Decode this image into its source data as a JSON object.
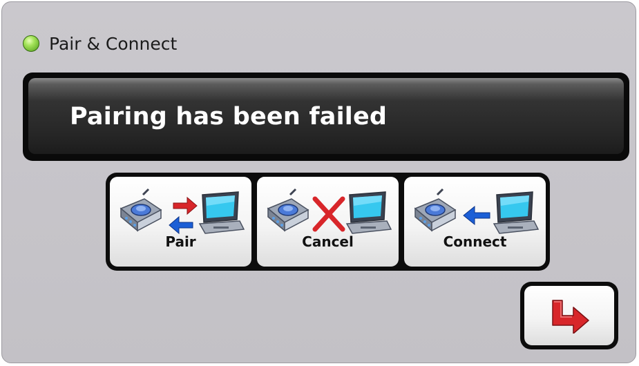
{
  "header": {
    "title": "Pair & Connect",
    "status_color": "#7cc832"
  },
  "message": {
    "text": "Pairing has been failed"
  },
  "actions": [
    {
      "label": "Pair",
      "icon": "device-pair-icon"
    },
    {
      "label": "Cancel",
      "icon": "device-cancel-icon"
    },
    {
      "label": "Connect",
      "icon": "device-connect-icon"
    }
  ],
  "navigation": {
    "next_icon": "forward-arrow-icon"
  },
  "colors": {
    "accent_red": "#d8262a",
    "accent_blue": "#1c5fd6",
    "message_text": "#ffffff"
  }
}
